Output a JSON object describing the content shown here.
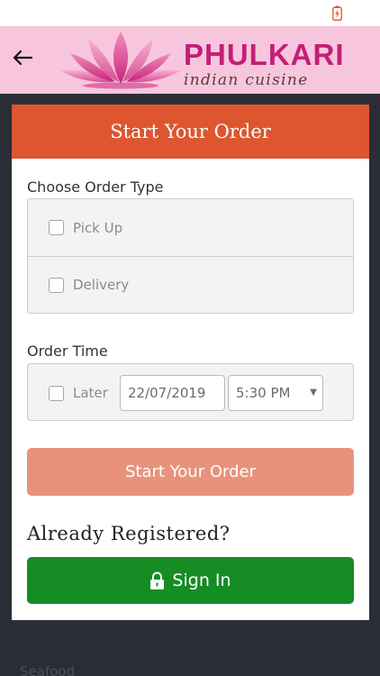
{
  "header": {
    "brand": "PHULKARI",
    "tagline": "indian cuisine"
  },
  "card": {
    "title": "Start Your Order",
    "order_type_label": "Choose Order Type",
    "options": [
      "Pick Up",
      "Delivery"
    ],
    "order_time_label": "Order Time",
    "later_label": "Later",
    "date_value": "22/07/2019",
    "time_value": "5:30 PM",
    "start_button": "Start Your Order",
    "registered_heading": "Already Registered?",
    "signin_button": "Sign In"
  },
  "background_text": "Seafood",
  "colors": {
    "header_pink": "#f7c6dd",
    "brand_magenta": "#c21f78",
    "card_header": "#dd5630",
    "start_button": "#e8927c",
    "signin_button": "#168c25",
    "page_dark": "#2b2d36"
  },
  "icons": {
    "status": "battery-charging-icon",
    "back": "arrow-left-icon",
    "logo": "lotus-icon",
    "signin": "lock-icon",
    "dropdown": "chevron-down-icon"
  }
}
